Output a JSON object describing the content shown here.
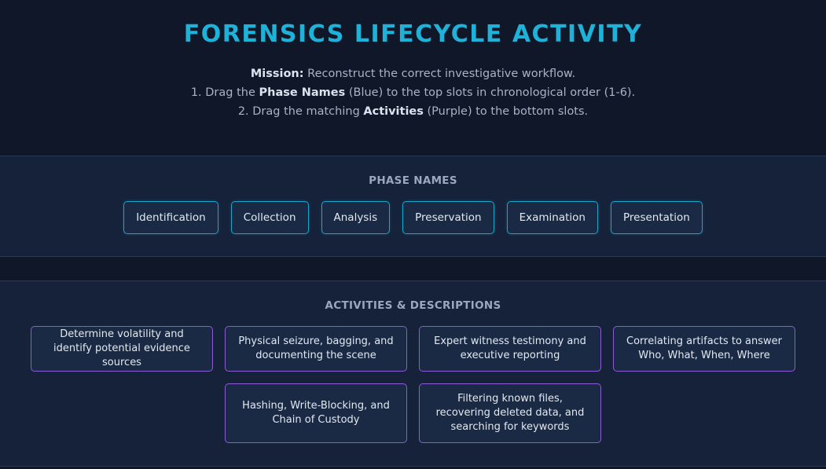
{
  "header": {
    "title": "FORENSICS LIFECYCLE ACTIVITY",
    "line1_label": "Mission:",
    "line1_text": " Reconstruct the correct investigative workflow.",
    "line2_prefix": "1. Drag the ",
    "line2_bold": "Phase Names",
    "line2_suffix": " (Blue) to the top slots in chronological order (1-6).",
    "line3_prefix": "2. Drag the matching ",
    "line3_bold": "Activities",
    "line3_suffix": " (Purple) to the bottom slots."
  },
  "phases": {
    "title": "PHASE NAMES",
    "items": [
      "Identification",
      "Collection",
      "Analysis",
      "Preservation",
      "Examination",
      "Presentation"
    ]
  },
  "activities": {
    "title": "ACTIVITIES & DESCRIPTIONS",
    "items": [
      "Determine volatility and identify potential evidence sources",
      "Physical seizure, bagging, and documenting the scene",
      "Expert witness testimony and executive reporting",
      "Correlating artifacts to answer Who, What, When, Where",
      "Hashing, Write-Blocking, and Chain of Custody",
      "Filtering known files, recovering deleted data, and searching for keywords"
    ]
  },
  "colors": {
    "accent_title": "#1fb2d9",
    "phase_border": "#19a7c9",
    "activity_border": "#8b5cd6",
    "background": "#0f1729"
  }
}
